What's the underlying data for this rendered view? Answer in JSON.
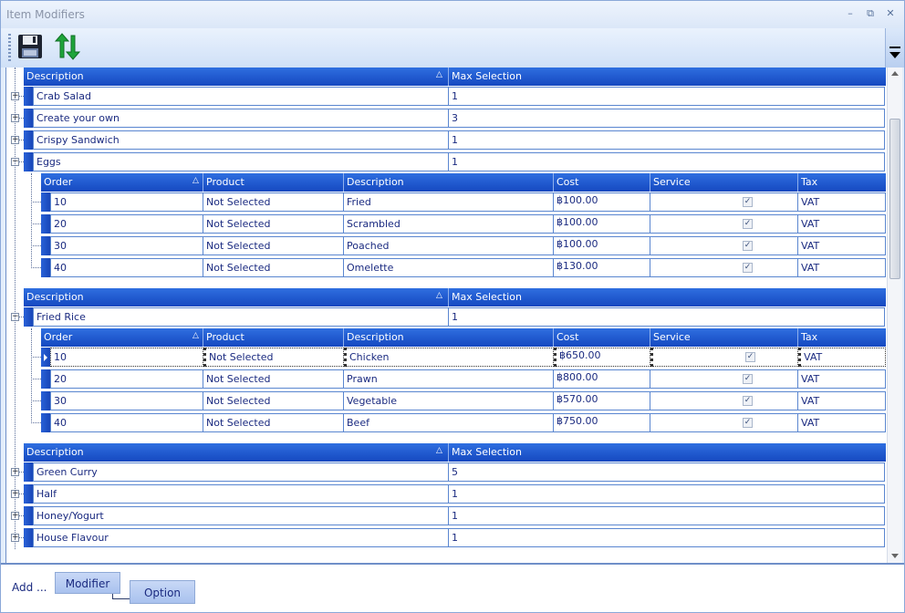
{
  "window": {
    "title": "Item Modifiers",
    "minimize": "–",
    "restore": "⧉",
    "close": "✕"
  },
  "toolbar": {
    "save_icon": "save-disk-icon",
    "refresh_icon": "refresh-arrows-icon"
  },
  "master_header": {
    "description": "Description",
    "max_selection": "Max Selection"
  },
  "detail_header": {
    "order": "Order",
    "product": "Product",
    "description": "Description",
    "cost": "Cost",
    "service": "Service",
    "tax": "Tax"
  },
  "groups": [
    {
      "rows": [
        {
          "description": "Crab Salad",
          "max": "1",
          "expanded": false
        },
        {
          "description": "Create your own",
          "max": "3",
          "expanded": false
        },
        {
          "description": "Crispy Sandwich",
          "max": "1",
          "expanded": false
        },
        {
          "description": "Eggs",
          "max": "1",
          "expanded": true,
          "options": [
            {
              "order": "10",
              "product": "Not Selected",
              "description": "Fried",
              "cost": "฿100.00",
              "service": true,
              "tax": "VAT"
            },
            {
              "order": "20",
              "product": "Not Selected",
              "description": "Scrambled",
              "cost": "฿100.00",
              "service": true,
              "tax": "VAT"
            },
            {
              "order": "30",
              "product": "Not Selected",
              "description": "Poached",
              "cost": "฿100.00",
              "service": true,
              "tax": "VAT"
            },
            {
              "order": "40",
              "product": "Not Selected",
              "description": "Omelette",
              "cost": "฿130.00",
              "service": true,
              "tax": "VAT"
            }
          ]
        }
      ]
    },
    {
      "rows": [
        {
          "description": "Fried Rice",
          "max": "1",
          "expanded": true,
          "options": [
            {
              "order": "10",
              "product": "Not Selected",
              "description": "Chicken",
              "cost": "฿650.00",
              "service": true,
              "tax": "VAT",
              "current": true
            },
            {
              "order": "20",
              "product": "Not Selected",
              "description": "Prawn",
              "cost": "฿800.00",
              "service": true,
              "tax": "VAT"
            },
            {
              "order": "30",
              "product": "Not Selected",
              "description": "Vegetable",
              "cost": "฿570.00",
              "service": true,
              "tax": "VAT"
            },
            {
              "order": "40",
              "product": "Not Selected",
              "description": "Beef",
              "cost": "฿750.00",
              "service": true,
              "tax": "VAT"
            }
          ]
        }
      ]
    },
    {
      "rows": [
        {
          "description": "Green Curry",
          "max": "5",
          "expanded": false
        },
        {
          "description": "Half",
          "max": "1",
          "expanded": false
        },
        {
          "description": "Honey/Yogurt",
          "max": "1",
          "expanded": false
        },
        {
          "description": "House Flavour",
          "max": "1",
          "expanded": false
        }
      ]
    }
  ],
  "bottom": {
    "add_label": "Add ...",
    "modifier_button": "Modifier",
    "option_button": "Option"
  },
  "colors": {
    "header_blue": "#1f5ad6",
    "text_blue": "#1a2a80",
    "border_blue": "#5a86d0"
  }
}
